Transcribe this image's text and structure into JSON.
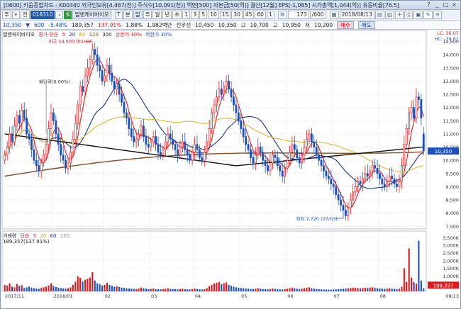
{
  "window": {
    "title": "[0600] 키움종합차트 - K00340 외국인보유[4,467(천)] 주식수[10,091(천)] 액면[500] 자본금[50(억)] 결산[12월] EPS[-1,085] 시가총액[1,044(억)] 유동비율[76.5]",
    "buttons": [
      "?",
      "_",
      "□",
      "×"
    ]
  },
  "toolbar": {
    "items": [
      "주",
      "▾",
      "전",
      "018310"
    ],
    "stock_name": "엘앤케이바이오",
    "periods": [
      "T",
      "분",
      "일",
      "주",
      "월",
      "년",
      "초",
      "1",
      "3",
      "5",
      "10",
      "15",
      "30",
      "45",
      "60",
      "1"
    ],
    "count": "173",
    "total": "/600",
    "date": "2018/08/13"
  },
  "quote": {
    "price": "10,350",
    "change": "600",
    "rate": "-5.48%",
    "volume": "189,357",
    "vol_rate": "137.91%",
    "extra": "1.88%",
    "amount": "1,982백만",
    "prev_label": "전우선",
    "prev": "10,450",
    "open": "10,350",
    "high_label": "고",
    "high": "10,700",
    "high2_label": "고",
    "high2": "10,950",
    "low_label": "저",
    "low": "10,200",
    "buy": "매수",
    "sell": "매도"
  },
  "legend": {
    "price": "엘앤케이바이오",
    "ma_label": "종가 단순",
    "ma": [
      "5",
      "20",
      "60",
      "120",
      "300"
    ],
    "upper": "상한가 30%",
    "lower": "하한가 30%"
  },
  "volume_legend": {
    "label": "거래량",
    "ma_label": "단순",
    "ma": [
      "5",
      "20",
      "60",
      "120"
    ],
    "value": "189,357(137.91%)"
  },
  "annotations": {
    "high": "최고 14,500 (01/10)",
    "low": "최저 7,720 (07/03)",
    "dividend": "배당락(0.00%)",
    "lc": "LC: 36.07",
    "hc": "HC: -39.62"
  },
  "price_badge": "10,350",
  "volume_badge": "189,357",
  "colors": {
    "up": "#e0191c",
    "down": "#1d4fc2",
    "ma5": "#e0191c",
    "ma20": "#1c2f8f",
    "ma60": "#e0b82a",
    "ma120": "#8a4a1c",
    "ma300": "#111111"
  },
  "chart_data": {
    "type": "candlestick",
    "title": "",
    "x_ticks": [
      "2017/11",
      "2018/01",
      "02",
      "03",
      "04",
      "05",
      "06",
      "07",
      "08"
    ],
    "price_ticks": [
      14500,
      14000,
      13500,
      13000,
      12500,
      12000,
      11500,
      11000,
      10500,
      10000,
      9500,
      9000,
      8500,
      8000,
      7500
    ],
    "price_ylim": [
      7400,
      14650
    ],
    "volume_ticks": [
      "3,500K",
      "3,000K",
      "2,500K",
      "2,000K",
      "1,500K",
      "1,000K",
      "500K"
    ],
    "volume_ylim": [
      0,
      3700000
    ],
    "date_end": "08/13",
    "close": [
      10200,
      10500,
      11000,
      10700,
      11300,
      11700,
      11400,
      11900,
      11600,
      11000,
      10800,
      10400,
      10000,
      9800,
      9600,
      9900,
      10200,
      10600,
      11200,
      11800,
      11500,
      11000,
      10600,
      10200,
      10000,
      9700,
      9900,
      10300,
      10800,
      11400,
      12100,
      12800,
      12600,
      13200,
      13500,
      13800,
      14200,
      14000,
      13600,
      13400,
      13000,
      13200,
      13600,
      13300,
      13000,
      12700,
      12900,
      12500,
      12200,
      11800,
      11600,
      11200,
      10900,
      10700,
      10800,
      11000,
      11300,
      10900,
      10600,
      10500,
      10700,
      10900,
      10600,
      10300,
      10200,
      10400,
      10700,
      11000,
      10800,
      10600,
      10400,
      10200,
      10500,
      10700,
      10400,
      10200,
      10000,
      10300,
      10600,
      10400,
      10100,
      10000,
      10300,
      10700,
      11200,
      11800,
      12100,
      12400,
      12700,
      12500,
      12800,
      13000,
      12700,
      12400,
      12100,
      11800,
      11500,
      11200,
      10900,
      10600,
      10400,
      10100,
      9900,
      10200,
      10500,
      10300,
      10000,
      9800,
      9600,
      9900,
      10200,
      10100,
      9800,
      9600,
      9400,
      9700,
      10000,
      10300,
      10600,
      10400,
      10100,
      9900,
      10200,
      10500,
      10800,
      11000,
      10700,
      10500,
      10200,
      10000,
      9800,
      9600,
      9400,
      9300,
      9100,
      9000,
      8700,
      8500,
      8300,
      8100,
      7900,
      8200,
      8500,
      8800,
      9000,
      9200,
      9100,
      9300,
      9500,
      9400,
      9600,
      9800,
      9700,
      9500,
      9300,
      9100,
      9000,
      9200,
      9400,
      9300,
      9100,
      9000,
      9200,
      9800,
      10600,
      11200,
      11800,
      12000,
      11600,
      12400,
      12300,
      11600,
      10350
    ],
    "open": [
      10000,
      10200,
      10500,
      11000,
      10700,
      11300,
      11700,
      11400,
      11900,
      11600,
      11000,
      10800,
      10400,
      10000,
      9800,
      9600,
      9900,
      10200,
      10600,
      11200,
      11800,
      11500,
      11000,
      10600,
      10200,
      10000,
      9700,
      9900,
      10300,
      10800,
      11400,
      12100,
      12800,
      12600,
      13200,
      13500,
      13800,
      14200,
      14000,
      13600,
      13400,
      13000,
      13200,
      13600,
      13300,
      13000,
      12700,
      12900,
      12500,
      12200,
      11800,
      11600,
      11200,
      10900,
      10700,
      10800,
      11000,
      11300,
      10900,
      10600,
      10500,
      10700,
      10900,
      10600,
      10300,
      10200,
      10400,
      10700,
      11000,
      10800,
      10600,
      10400,
      10200,
      10500,
      10700,
      10400,
      10200,
      10000,
      10300,
      10600,
      10400,
      10100,
      10000,
      10300,
      10700,
      11200,
      11800,
      12100,
      12400,
      12700,
      12500,
      12800,
      13000,
      12700,
      12400,
      12100,
      11800,
      11500,
      11200,
      10900,
      10600,
      10400,
      10100,
      9900,
      10200,
      10500,
      10300,
      10000,
      9800,
      9600,
      9900,
      10200,
      10100,
      9800,
      9600,
      9400,
      9700,
      10000,
      10300,
      10600,
      10400,
      10100,
      9900,
      10200,
      10500,
      10800,
      11000,
      10700,
      10500,
      10200,
      10000,
      9800,
      9600,
      9400,
      9300,
      9100,
      9000,
      8700,
      8500,
      8300,
      8100,
      7900,
      8200,
      8500,
      8800,
      9000,
      9200,
      9100,
      9300,
      9500,
      9400,
      9600,
      9800,
      9700,
      9500,
      9300,
      9100,
      9000,
      9200,
      9400,
      9300,
      9100,
      9000,
      9200,
      9800,
      10600,
      11200,
      11800,
      12000,
      11600,
      12400,
      12300,
      11000
    ],
    "volume": [
      420000,
      380000,
      520000,
      300000,
      260000,
      480000,
      350000,
      400000,
      220000,
      260000,
      300000,
      240000,
      200000,
      180000,
      160000,
      220000,
      260000,
      300000,
      380000,
      520000,
      340000,
      280000,
      240000,
      210000,
      190000,
      170000,
      200000,
      260000,
      420000,
      620000,
      980000,
      880000,
      640000,
      760000,
      820000,
      900000,
      1250000,
      700000,
      520000,
      460000,
      380000,
      420000,
      560000,
      420000,
      360000,
      300000,
      320000,
      280000,
      240000,
      220000,
      200000,
      180000,
      170000,
      160000,
      150000,
      180000,
      240000,
      200000,
      170000,
      150000,
      160000,
      180000,
      150000,
      140000,
      130000,
      150000,
      170000,
      200000,
      160000,
      150000,
      140000,
      130000,
      150000,
      170000,
      140000,
      130000,
      120000,
      150000,
      180000,
      150000,
      130000,
      120000,
      140000,
      200000,
      320000,
      420000,
      500000,
      560000,
      600000,
      460000,
      520000,
      580000,
      420000,
      360000,
      300000,
      260000,
      240000,
      220000,
      200000,
      180000,
      170000,
      160000,
      150000,
      170000,
      200000,
      170000,
      150000,
      140000,
      130000,
      150000,
      180000,
      160000,
      140000,
      130000,
      120000,
      140000,
      170000,
      200000,
      240000,
      200000,
      170000,
      150000,
      170000,
      200000,
      240000,
      260000,
      200000,
      170000,
      150000,
      140000,
      130000,
      120000,
      120000,
      110000,
      110000,
      110000,
      130000,
      140000,
      150000,
      160000,
      180000,
      200000,
      220000,
      240000,
      220000,
      200000,
      190000,
      210000,
      230000,
      210000,
      240000,
      260000,
      220000,
      200000,
      180000,
      170000,
      160000,
      170000,
      190000,
      170000,
      160000,
      150000,
      170000,
      300000,
      1500000,
      600000,
      2800000,
      900000,
      600000,
      500000,
      3300000,
      700000,
      189357
    ],
    "series": [
      {
        "name": "5",
        "type": "ma",
        "period": 5
      },
      {
        "name": "20",
        "type": "ma",
        "period": 20
      },
      {
        "name": "60",
        "type": "ma",
        "period": 60
      },
      {
        "name": "120",
        "type": "ma",
        "period": 120
      },
      {
        "name": "300",
        "type": "ma",
        "period": 300
      }
    ]
  }
}
